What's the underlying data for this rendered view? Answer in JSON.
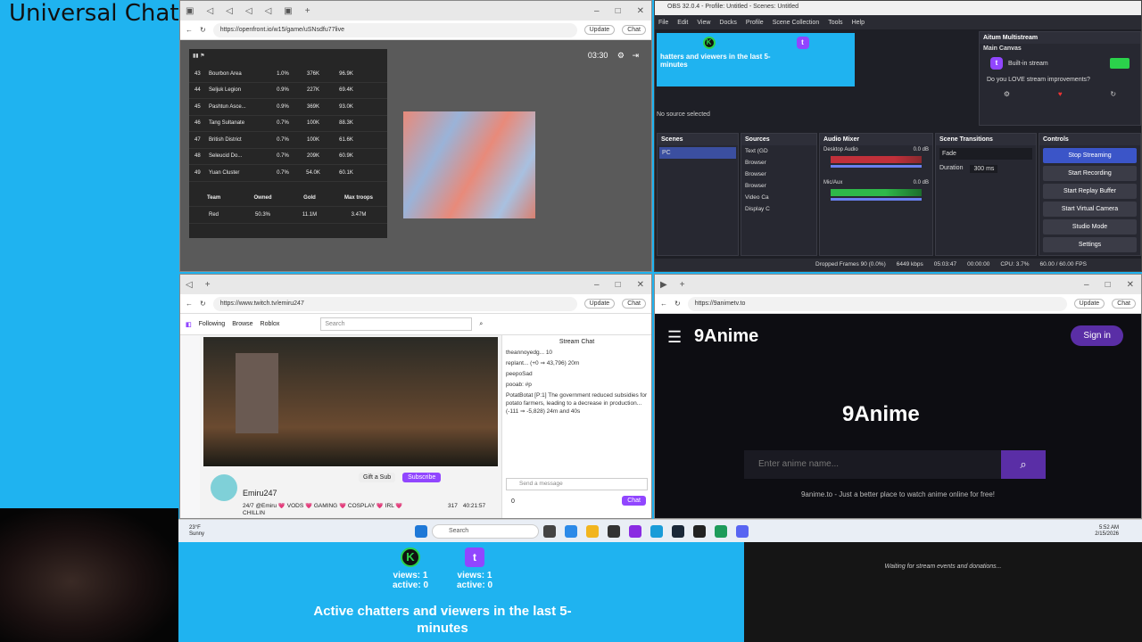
{
  "title": "Universal Chat",
  "openfront": {
    "url": "https://openfront.io/w15/game/uSNsdfu77live",
    "timer": "03:30",
    "rows": [
      {
        "rank": "43",
        "name": "Bourbon Area",
        "pct": "1.0%",
        "gold": "376K",
        "troops": "96.9K"
      },
      {
        "rank": "44",
        "name": "Seljuk Legion",
        "pct": "0.9%",
        "gold": "227K",
        "troops": "69.4K"
      },
      {
        "rank": "45",
        "name": "Pashtun Asce...",
        "pct": "0.9%",
        "gold": "369K",
        "troops": "93.0K"
      },
      {
        "rank": "46",
        "name": "Tang Sultanate",
        "pct": "0.7%",
        "gold": "100K",
        "troops": "88.3K"
      },
      {
        "rank": "47",
        "name": "British District",
        "pct": "0.7%",
        "gold": "100K",
        "troops": "61.6K"
      },
      {
        "rank": "48",
        "name": "Seleucid Do...",
        "pct": "0.7%",
        "gold": "209K",
        "troops": "60.9K"
      },
      {
        "rank": "49",
        "name": "Yuan Cluster",
        "pct": "0.7%",
        "gold": "54.0K",
        "troops": "60.1K"
      }
    ],
    "team_headers": [
      "Team",
      "Owned",
      "Gold",
      "Max troops"
    ],
    "team_row": {
      "team": "Red",
      "owned": "50.3%",
      "gold": "11.1M",
      "troops": "3.47M"
    }
  },
  "obs": {
    "menu": [
      "File",
      "Edit",
      "View",
      "Docks",
      "Profile",
      "Scene Collection",
      "Tools",
      "Help"
    ],
    "preview_text": "hatters and viewers in the last 5-minutes",
    "no_source": "No source selected",
    "multistream_title": "Aitum Multistream",
    "main_canvas": "Main Canvas",
    "builtin": "Built-in stream",
    "love": "Do you LOVE stream improvements?",
    "docks": {
      "scenes": "Scenes",
      "sources": "Sources",
      "mixer": "Audio Mixer",
      "transitions": "Scene Transitions",
      "controls": "Controls"
    },
    "scene": "PC",
    "sources_list": [
      "Text (GD",
      "Browser",
      "Browser",
      "Browser",
      "Video Ca",
      "Display C"
    ],
    "desktop_audio": "Desktop Audio",
    "mic": "Mic/Aux",
    "db": "0.0 dB",
    "fade": "Fade",
    "duration_label": "Duration",
    "duration": "300 ms",
    "controls": [
      "Stop Streaming",
      "Start Recording",
      "Start Replay Buffer",
      "Start Virtual Camera",
      "Studio Mode",
      "Settings"
    ],
    "status": {
      "dropped": "Dropped Frames 90 (0.0%)",
      "kbps": "6449 kbps",
      "live": "05:03:47",
      "rec": "00:00:00",
      "cpu": "CPU: 3.7%",
      "fps": "60.00 / 60.00 FPS"
    }
  },
  "twitch": {
    "url": "https://www.twitch.tv/emiru247",
    "nav": [
      "Following",
      "Browse",
      "Roblox"
    ],
    "search_placeholder": "Search",
    "chat_title": "Stream Chat",
    "channel": "Emiru247",
    "stream_title": "24/7 @Emiru 💗 VODS 💗 GAMING 💗 COSPLAY 💗 IRL 💗 CHILLIN",
    "viewers": "317",
    "uptime": "40:21:57",
    "gift": "Gift a Sub",
    "subscribe": "Subscribe",
    "send_placeholder": "Send a message",
    "chat_button": "Chat",
    "points": "0",
    "chat_lines": [
      "theannoyedg... 10",
      "replant... (+0 ⇒ 43,796) 20m",
      "peepoSad",
      "pooab: #p",
      "PotatBotat [P:1] The government reduced subsidies for potato farmers, leading to a decrease in production... (-111 ⇒ -5,828) 24m and 40s"
    ]
  },
  "anime": {
    "url": "https://9animetv.to",
    "logo": "9Anime",
    "signin": "Sign in",
    "search_placeholder": "Enter anime name...",
    "tagline": "9anime.to - Just a better place to watch anime online for free!"
  },
  "taskbar": {
    "weather_temp": "23°F",
    "weather_desc": "Sunny",
    "search": "Search",
    "time": "5:52 AM",
    "date": "2/15/2026"
  },
  "overlay": {
    "kick_views": "views: 1",
    "kick_active": "active: 0",
    "twitch_views": "views: 1",
    "twitch_active": "active: 0",
    "headline": "Active chatters and viewers in the last 5-minutes",
    "donation": "Waiting for stream events and donations..."
  },
  "colors": {
    "background": "#1fb3f0",
    "twitch": "#9146ff",
    "kick": "#2bd24b",
    "anime_accent": "#5a2ea6"
  }
}
